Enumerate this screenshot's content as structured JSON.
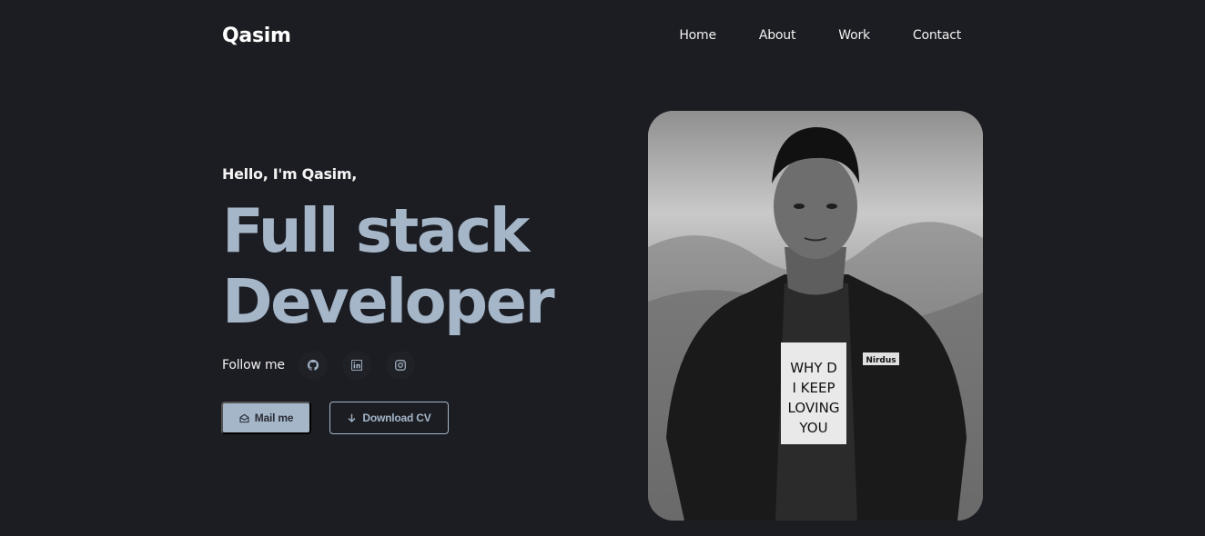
{
  "header": {
    "logo": "Qasim",
    "nav": [
      "Home",
      "About",
      "Work",
      "Contact"
    ]
  },
  "hero": {
    "greeting": "Hello, I'm Qasim,",
    "headline_line1": "Full stack",
    "headline_line2": "Developer",
    "follow_label": "Follow me",
    "socials": [
      "github-icon",
      "linkedin-icon",
      "instagram-icon"
    ],
    "mail_button": "Mail me",
    "cv_button": "Download CV",
    "photo_shirt_text": [
      "WHY D",
      "I KEEP",
      "LOVING",
      "YOU"
    ],
    "photo_badge": "Nirdus"
  },
  "colors": {
    "background": "#1c1d22",
    "accent": "#a5b6c9"
  }
}
